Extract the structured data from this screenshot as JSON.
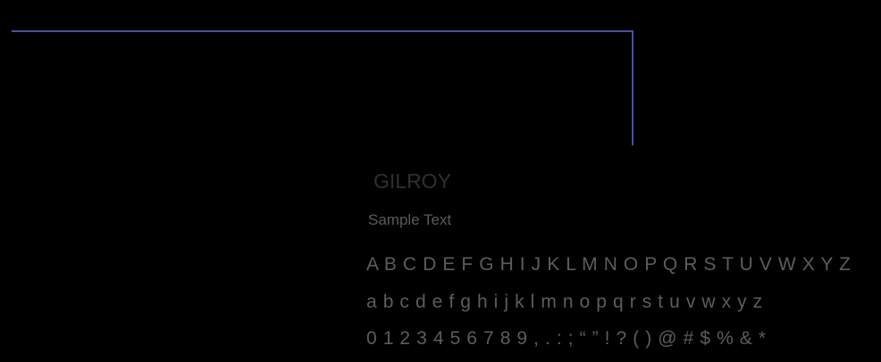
{
  "colors": {
    "background": "#000000",
    "accent_line": "#4a4fa0",
    "title_text": "#2f2f2f",
    "body_text": "#5c5c5c"
  },
  "specimen": {
    "font_name": "GILROY",
    "sample_label": "Sample Text",
    "uppercase": "A B C D E F G H I J K L M N O P Q R S T U V W X Y Z",
    "lowercase": "a b c d e f g h i j k l m n o p q r s t u v w x y z",
    "numerals_symbols": "0 1 2 3 4 5 6 7 8 9 , . : ; “ ” ! ? ( ) @ # $ % & *"
  }
}
